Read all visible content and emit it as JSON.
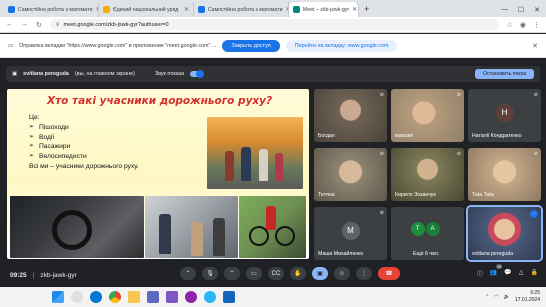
{
  "browser": {
    "tabs": [
      {
        "title": "Самостійна робота з математи",
        "active": false,
        "favicon_color": "#1a73e8"
      },
      {
        "title": "Єдиний національний уряд",
        "active": false,
        "favicon_color": "#f9ab00"
      },
      {
        "title": "Самостійна робота з математи",
        "active": false,
        "favicon_color": "#1a73e8"
      },
      {
        "title": "Meet – zkb-jswk-gyr",
        "active": true,
        "favicon_color": "#00897b"
      }
    ],
    "new_tab": "+",
    "url": "meet.google.com/zkb-jswk-gyr?authuser=0"
  },
  "infobar": {
    "message": "Оправлка вкладки \"https://www.google.com\" в приложение \"meet.google.com\" ...",
    "primary_button": "Закрыть доступ",
    "secondary_button": "Перейти на вкладку: www.google.com"
  },
  "meet": {
    "presenter_bar": {
      "name": "svitlana pereguda",
      "status": "(вы, на главном экране)",
      "show_sound_label": "Звук показа",
      "stop_button": "Остановить показ"
    },
    "slide": {
      "title": "Хто такі учасники дорожнього руху?",
      "intro": "Це:",
      "items": [
        "Пішоходи",
        "Водії",
        "Пасажири",
        "Велосипедисти"
      ],
      "conclusion": "Всі ми – учасники дорожнього руху."
    },
    "participants": [
      {
        "name": "Богдан",
        "type": "video",
        "tone": "#7a6a5c"
      },
      {
        "name": "максим",
        "type": "video",
        "tone": "#b49a7a"
      },
      {
        "name": "Наталії Кондратенко",
        "type": "avatar",
        "initial": "Н",
        "color": "#5d4037"
      },
      {
        "name": "Тетяна",
        "type": "video",
        "tone": "#8d8370"
      },
      {
        "name": "Кирило Зозанчук",
        "type": "video",
        "tone": "#7d7a56"
      },
      {
        "name": "Таtа Таtа",
        "type": "video",
        "tone": "#c2a685"
      },
      {
        "name": "Маша Михайленко",
        "type": "avatar",
        "initial": "М",
        "color": "#5f6368"
      },
      {
        "name": "Ещё 6 чел.",
        "type": "group",
        "initials": [
          "Т",
          "А"
        ],
        "colors": [
          "#1e8e3e",
          "#188038"
        ]
      },
      {
        "name": "svitlana pereguda",
        "type": "video",
        "tone": "#4a5a7a"
      }
    ],
    "toolbar": {
      "time": "09:25",
      "meeting_code": "zkb-jawk-gyr",
      "participants_count": "15"
    }
  },
  "taskbar": {
    "time": "9:25",
    "date": "17.01.2024"
  }
}
